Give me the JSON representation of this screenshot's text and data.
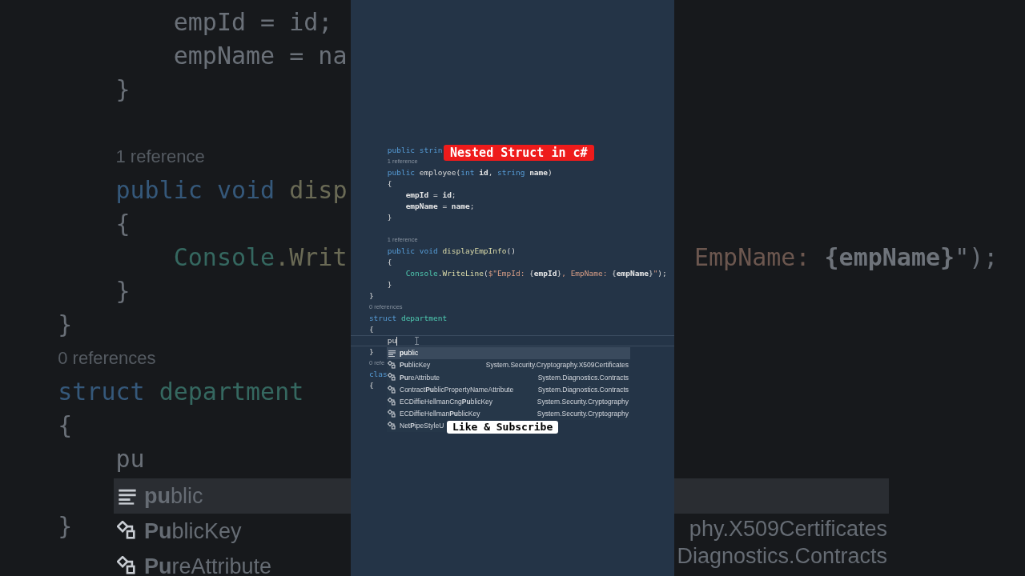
{
  "title_banner": "Nested Struct in c#",
  "subscribe_banner": "Like & Subscribe",
  "editor": {
    "lines": [
      {
        "kind": "code",
        "current": false,
        "tokens": [
          {
            "text": "        public ",
            "kind": "keyword"
          },
          {
            "text": "strin",
            "kind": "keyword"
          }
        ]
      },
      {
        "kind": "lens",
        "text": "        1 reference"
      },
      {
        "kind": "code",
        "current": false,
        "tokens": [
          {
            "text": "        public ",
            "kind": "keyword"
          },
          {
            "text": "employee(",
            "kind": "plain"
          },
          {
            "text": "int ",
            "kind": "keyword"
          },
          {
            "text": "id",
            "kind": "param"
          },
          {
            "text": ", ",
            "kind": "plain"
          },
          {
            "text": "string ",
            "kind": "keyword"
          },
          {
            "text": "name",
            "kind": "param"
          },
          {
            "text": ")",
            "kind": "plain"
          }
        ]
      },
      {
        "kind": "code",
        "current": false,
        "tokens": [
          {
            "text": "        {",
            "kind": "plain"
          }
        ]
      },
      {
        "kind": "code",
        "current": false,
        "tokens": [
          {
            "text": "            empId",
            "kind": "param"
          },
          {
            "text": " = ",
            "kind": "plain"
          },
          {
            "text": "id",
            "kind": "param"
          },
          {
            "text": ";",
            "kind": "plain"
          }
        ]
      },
      {
        "kind": "code",
        "current": false,
        "tokens": [
          {
            "text": "            empName",
            "kind": "param"
          },
          {
            "text": " = ",
            "kind": "plain"
          },
          {
            "text": "name",
            "kind": "param"
          },
          {
            "text": ";",
            "kind": "plain"
          }
        ]
      },
      {
        "kind": "code",
        "current": false,
        "tokens": [
          {
            "text": "        }",
            "kind": "plain"
          }
        ]
      },
      {
        "kind": "blank"
      },
      {
        "kind": "lens",
        "text": "        1 reference"
      },
      {
        "kind": "code",
        "current": false,
        "tokens": [
          {
            "text": "        public void ",
            "kind": "keyword"
          },
          {
            "text": "displayEmpInfo",
            "kind": "method"
          },
          {
            "text": "()",
            "kind": "plain"
          }
        ]
      },
      {
        "kind": "code",
        "current": false,
        "tokens": [
          {
            "text": "        {",
            "kind": "plain"
          }
        ]
      },
      {
        "kind": "code",
        "current": false,
        "tokens": [
          {
            "text": "            Console",
            "kind": "class"
          },
          {
            "text": ".",
            "kind": "plain"
          },
          {
            "text": "WriteLine",
            "kind": "method"
          },
          {
            "text": "(",
            "kind": "plain"
          },
          {
            "text": "$\"EmpId: ",
            "kind": "string"
          },
          {
            "text": "{",
            "kind": "plain"
          },
          {
            "text": "empId",
            "kind": "param"
          },
          {
            "text": "}",
            "kind": "plain"
          },
          {
            "text": ", EmpName: ",
            "kind": "string"
          },
          {
            "text": "{",
            "kind": "plain"
          },
          {
            "text": "empName",
            "kind": "param"
          },
          {
            "text": "}",
            "kind": "plain"
          },
          {
            "text": "\"",
            "kind": "string"
          },
          {
            "text": ");",
            "kind": "plain"
          }
        ]
      },
      {
        "kind": "code",
        "current": false,
        "tokens": [
          {
            "text": "        }",
            "kind": "plain"
          }
        ]
      },
      {
        "kind": "code",
        "current": false,
        "tokens": [
          {
            "text": "    }",
            "kind": "plain"
          }
        ]
      },
      {
        "kind": "lens",
        "text": "    0 references"
      },
      {
        "kind": "code",
        "current": false,
        "tokens": [
          {
            "text": "    struct ",
            "kind": "keyword"
          },
          {
            "text": "department",
            "kind": "class"
          }
        ]
      },
      {
        "kind": "code",
        "current": false,
        "tokens": [
          {
            "text": "    {",
            "kind": "plain"
          }
        ]
      },
      {
        "kind": "code",
        "current": true,
        "tokens": [
          {
            "text": "        pu",
            "kind": "plain"
          }
        ]
      },
      {
        "kind": "code",
        "current": false,
        "tokens": [
          {
            "text": "    }",
            "kind": "plain"
          }
        ]
      },
      {
        "kind": "lens",
        "text": "    0 refe"
      },
      {
        "kind": "code",
        "current": false,
        "tokens": [
          {
            "text": "    clas",
            "kind": "keyword"
          }
        ]
      },
      {
        "kind": "code",
        "current": false,
        "tokens": [
          {
            "text": "    {",
            "kind": "plain"
          }
        ]
      }
    ],
    "completion": [
      {
        "label": "**pu**blic",
        "kind": "keyword",
        "selected": true
      },
      {
        "label": "**Pu**blicKey",
        "namespace": "System.Security.Cryptography.X509Certificates",
        "kind": "class",
        "selected": false
      },
      {
        "label": "**Pu**reAttribute",
        "namespace": "System.Diagnostics.Contracts",
        "kind": "class",
        "selected": false
      },
      {
        "label": "Contract**Pu**blicPropertyNameAttribute",
        "namespace": "System.Diagnostics.Contracts",
        "kind": "class",
        "selected": false
      },
      {
        "label": "ECDiffieHellmanCng**Pu**blicKey",
        "namespace": "System.Security.Cryptography",
        "kind": "class",
        "selected": false
      },
      {
        "label": "ECDiffieHellman**Pu**blicKey",
        "namespace": "System.Security.Cryptography",
        "kind": "class",
        "selected": false
      },
      {
        "label": "Net**P**ipeStyleU",
        "kind": "class",
        "selected": false
      }
    ]
  },
  "backdrop_left": {
    "lines": [
      {
        "kind": "code",
        "tokens": [
          {
            "text": "            empId = id;",
            "kind": "plain"
          }
        ]
      },
      {
        "kind": "code",
        "tokens": [
          {
            "text": "            empName = na",
            "kind": "plain"
          }
        ]
      },
      {
        "kind": "code",
        "tokens": [
          {
            "text": "        }",
            "kind": "plain"
          }
        ]
      },
      {
        "kind": "blank"
      },
      {
        "kind": "lens",
        "text": "        1 reference"
      },
      {
        "kind": "code",
        "tokens": [
          {
            "text": "        public void ",
            "kind": "keyword"
          },
          {
            "text": "disp",
            "kind": "method"
          }
        ]
      },
      {
        "kind": "code",
        "tokens": [
          {
            "text": "        {",
            "kind": "plain"
          }
        ]
      },
      {
        "kind": "code",
        "tokens": [
          {
            "text": "            Console",
            "kind": "class"
          },
          {
            "text": ".Writ",
            "kind": "method"
          }
        ]
      },
      {
        "kind": "code",
        "tokens": [
          {
            "text": "        }",
            "kind": "plain"
          }
        ]
      },
      {
        "kind": "code",
        "tokens": [
          {
            "text": "    }",
            "kind": "plain"
          }
        ]
      },
      {
        "kind": "lens",
        "text": "    0 references"
      },
      {
        "kind": "code",
        "tokens": [
          {
            "text": "    struct ",
            "kind": "keyword"
          },
          {
            "text": "department",
            "kind": "class"
          }
        ]
      },
      {
        "kind": "code",
        "tokens": [
          {
            "text": "    {",
            "kind": "plain"
          }
        ]
      },
      {
        "kind": "code",
        "tokens": [
          {
            "text": "        pu",
            "kind": "plain"
          }
        ]
      },
      {
        "kind": "blank"
      },
      {
        "kind": "code",
        "tokens": [
          {
            "text": "    }",
            "kind": "plain"
          }
        ]
      }
    ],
    "completion": [
      {
        "label": "**pu**blic",
        "kind": "keyword",
        "selected": true
      },
      {
        "label": "**Pu**blicKey",
        "kind": "class",
        "selected": false
      },
      {
        "label": "**Pu**reAttribute",
        "kind": "class",
        "selected": false
      }
    ]
  },
  "backdrop_right": {
    "line": [
      {
        "text": "EmpName: ",
        "kind": "string"
      },
      {
        "text": "{empName}",
        "kind": "param"
      },
      {
        "text": "\");",
        "kind": "plain"
      }
    ],
    "namespaces": [
      "phy.X509Certificates",
      "Diagnostics.Contracts"
    ]
  }
}
